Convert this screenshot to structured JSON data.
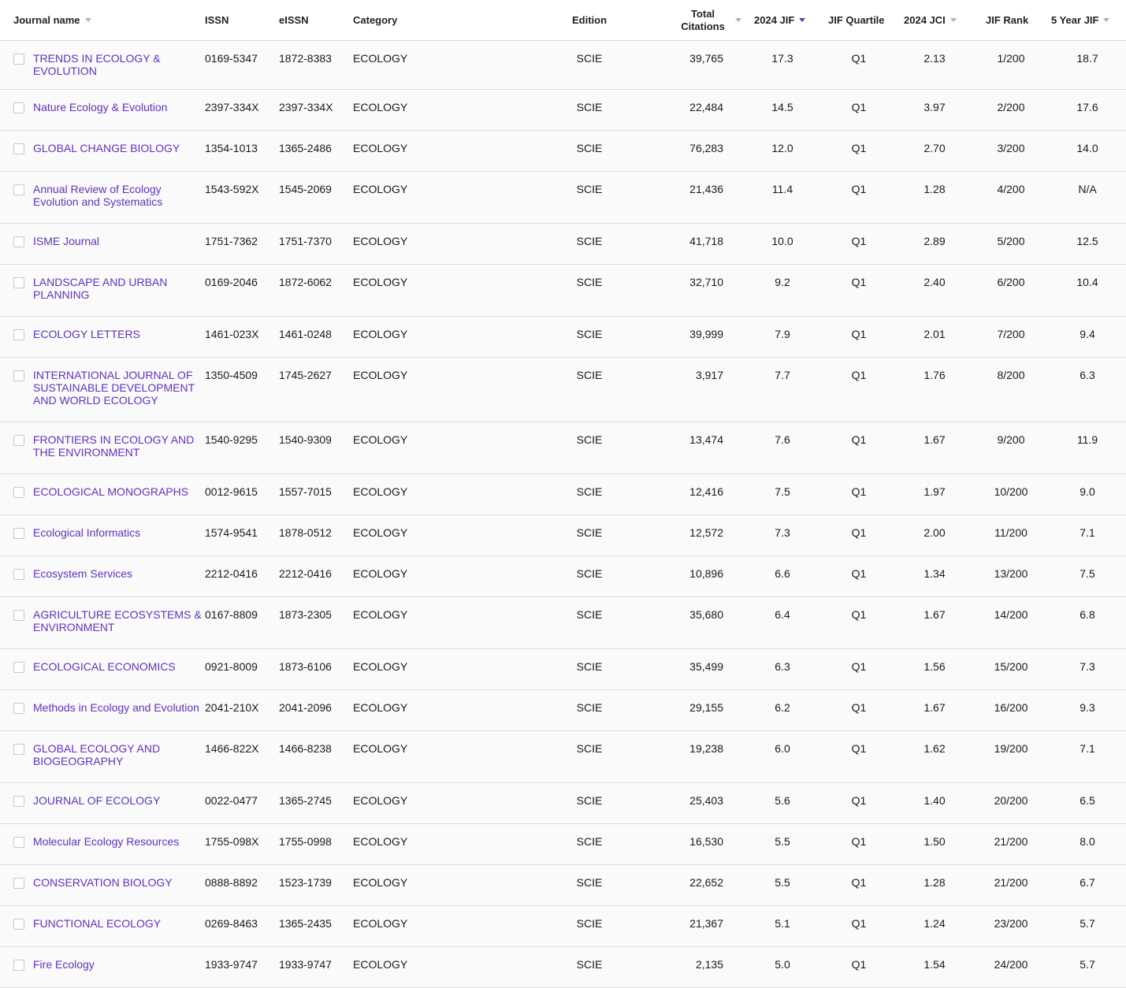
{
  "columns": {
    "journal_name": "Journal name",
    "issn": "ISSN",
    "eissn": "eISSN",
    "category": "Category",
    "edition": "Edition",
    "total_citations": "Total Citations",
    "jif": "2024 JIF",
    "jif_quartile": "JIF Quartile",
    "jci": "2024 JCI",
    "jif_rank": "JIF Rank",
    "five_year_jif": "5 Year JIF"
  },
  "sort_icon": "sort-caret-icon",
  "accent_color": "#5e33bf",
  "rows": [
    {
      "name": "TRENDS IN ECOLOGY & EVOLUTION",
      "issn": "0169-5347",
      "eissn": "1872-8383",
      "category": "ECOLOGY",
      "edition": "SCIE",
      "citations": "39,765",
      "jif": "17.3",
      "quartile": "Q1",
      "jci": "2.13",
      "rank": "1/200",
      "five_year": "18.7"
    },
    {
      "name": "Nature Ecology & Evolution",
      "issn": "2397-334X",
      "eissn": "2397-334X",
      "category": "ECOLOGY",
      "edition": "SCIE",
      "citations": "22,484",
      "jif": "14.5",
      "quartile": "Q1",
      "jci": "3.97",
      "rank": "2/200",
      "five_year": "17.6"
    },
    {
      "name": "GLOBAL CHANGE BIOLOGY",
      "issn": "1354-1013",
      "eissn": "1365-2486",
      "category": "ECOLOGY",
      "edition": "SCIE",
      "citations": "76,283",
      "jif": "12.0",
      "quartile": "Q1",
      "jci": "2.70",
      "rank": "3/200",
      "five_year": "14.0"
    },
    {
      "name": "Annual Review of Ecology Evolution and Systematics",
      "issn": "1543-592X",
      "eissn": "1545-2069",
      "category": "ECOLOGY",
      "edition": "SCIE",
      "citations": "21,436",
      "jif": "11.4",
      "quartile": "Q1",
      "jci": "1.28",
      "rank": "4/200",
      "five_year": "N/A"
    },
    {
      "name": "ISME Journal",
      "issn": "1751-7362",
      "eissn": "1751-7370",
      "category": "ECOLOGY",
      "edition": "SCIE",
      "citations": "41,718",
      "jif": "10.0",
      "quartile": "Q1",
      "jci": "2.89",
      "rank": "5/200",
      "five_year": "12.5"
    },
    {
      "name": "LANDSCAPE AND URBAN PLANNING",
      "issn": "0169-2046",
      "eissn": "1872-6062",
      "category": "ECOLOGY",
      "edition": "SCIE",
      "citations": "32,710",
      "jif": "9.2",
      "quartile": "Q1",
      "jci": "2.40",
      "rank": "6/200",
      "five_year": "10.4"
    },
    {
      "name": "ECOLOGY LETTERS",
      "issn": "1461-023X",
      "eissn": "1461-0248",
      "category": "ECOLOGY",
      "edition": "SCIE",
      "citations": "39,999",
      "jif": "7.9",
      "quartile": "Q1",
      "jci": "2.01",
      "rank": "7/200",
      "five_year": "9.4"
    },
    {
      "name": "INTERNATIONAL JOURNAL OF SUSTAINABLE DEVELOPMENT AND WORLD ECOLOGY",
      "issn": "1350-4509",
      "eissn": "1745-2627",
      "category": "ECOLOGY",
      "edition": "SCIE",
      "citations": "3,917",
      "jif": "7.7",
      "quartile": "Q1",
      "jci": "1.76",
      "rank": "8/200",
      "five_year": "6.3"
    },
    {
      "name": "FRONTIERS IN ECOLOGY AND THE ENVIRONMENT",
      "issn": "1540-9295",
      "eissn": "1540-9309",
      "category": "ECOLOGY",
      "edition": "SCIE",
      "citations": "13,474",
      "jif": "7.6",
      "quartile": "Q1",
      "jci": "1.67",
      "rank": "9/200",
      "five_year": "11.9"
    },
    {
      "name": "ECOLOGICAL MONOGRAPHS",
      "issn": "0012-9615",
      "eissn": "1557-7015",
      "category": "ECOLOGY",
      "edition": "SCIE",
      "citations": "12,416",
      "jif": "7.5",
      "quartile": "Q1",
      "jci": "1.97",
      "rank": "10/200",
      "five_year": "9.0"
    },
    {
      "name": "Ecological Informatics",
      "issn": "1574-9541",
      "eissn": "1878-0512",
      "category": "ECOLOGY",
      "edition": "SCIE",
      "citations": "12,572",
      "jif": "7.3",
      "quartile": "Q1",
      "jci": "2.00",
      "rank": "11/200",
      "five_year": "7.1"
    },
    {
      "name": "Ecosystem Services",
      "issn": "2212-0416",
      "eissn": "2212-0416",
      "category": "ECOLOGY",
      "edition": "SCIE",
      "citations": "10,896",
      "jif": "6.6",
      "quartile": "Q1",
      "jci": "1.34",
      "rank": "13/200",
      "five_year": "7.5"
    },
    {
      "name": "AGRICULTURE ECOSYSTEMS & ENVIRONMENT",
      "issn": "0167-8809",
      "eissn": "1873-2305",
      "category": "ECOLOGY",
      "edition": "SCIE",
      "citations": "35,680",
      "jif": "6.4",
      "quartile": "Q1",
      "jci": "1.67",
      "rank": "14/200",
      "five_year": "6.8"
    },
    {
      "name": "ECOLOGICAL ECONOMICS",
      "issn": "0921-8009",
      "eissn": "1873-6106",
      "category": "ECOLOGY",
      "edition": "SCIE",
      "citations": "35,499",
      "jif": "6.3",
      "quartile": "Q1",
      "jci": "1.56",
      "rank": "15/200",
      "five_year": "7.3"
    },
    {
      "name": "Methods in Ecology and Evolution",
      "issn": "2041-210X",
      "eissn": "2041-2096",
      "category": "ECOLOGY",
      "edition": "SCIE",
      "citations": "29,155",
      "jif": "6.2",
      "quartile": "Q1",
      "jci": "1.67",
      "rank": "16/200",
      "five_year": "9.3"
    },
    {
      "name": "GLOBAL ECOLOGY AND BIOGEOGRAPHY",
      "issn": "1466-822X",
      "eissn": "1466-8238",
      "category": "ECOLOGY",
      "edition": "SCIE",
      "citations": "19,238",
      "jif": "6.0",
      "quartile": "Q1",
      "jci": "1.62",
      "rank": "19/200",
      "five_year": "7.1"
    },
    {
      "name": "JOURNAL OF ECOLOGY",
      "issn": "0022-0477",
      "eissn": "1365-2745",
      "category": "ECOLOGY",
      "edition": "SCIE",
      "citations": "25,403",
      "jif": "5.6",
      "quartile": "Q1",
      "jci": "1.40",
      "rank": "20/200",
      "five_year": "6.5"
    },
    {
      "name": "Molecular Ecology Resources",
      "issn": "1755-098X",
      "eissn": "1755-0998",
      "category": "ECOLOGY",
      "edition": "SCIE",
      "citations": "16,530",
      "jif": "5.5",
      "quartile": "Q1",
      "jci": "1.50",
      "rank": "21/200",
      "five_year": "8.0"
    },
    {
      "name": "CONSERVATION BIOLOGY",
      "issn": "0888-8892",
      "eissn": "1523-1739",
      "category": "ECOLOGY",
      "edition": "SCIE",
      "citations": "22,652",
      "jif": "5.5",
      "quartile": "Q1",
      "jci": "1.28",
      "rank": "21/200",
      "five_year": "6.7"
    },
    {
      "name": "FUNCTIONAL ECOLOGY",
      "issn": "0269-8463",
      "eissn": "1365-2435",
      "category": "ECOLOGY",
      "edition": "SCIE",
      "citations": "21,367",
      "jif": "5.1",
      "quartile": "Q1",
      "jci": "1.24",
      "rank": "23/200",
      "five_year": "5.7"
    },
    {
      "name": "Fire Ecology",
      "issn": "1933-9747",
      "eissn": "1933-9747",
      "category": "ECOLOGY",
      "edition": "SCIE",
      "citations": "2,135",
      "jif": "5.0",
      "quartile": "Q1",
      "jci": "1.54",
      "rank": "24/200",
      "five_year": "5.7"
    }
  ]
}
